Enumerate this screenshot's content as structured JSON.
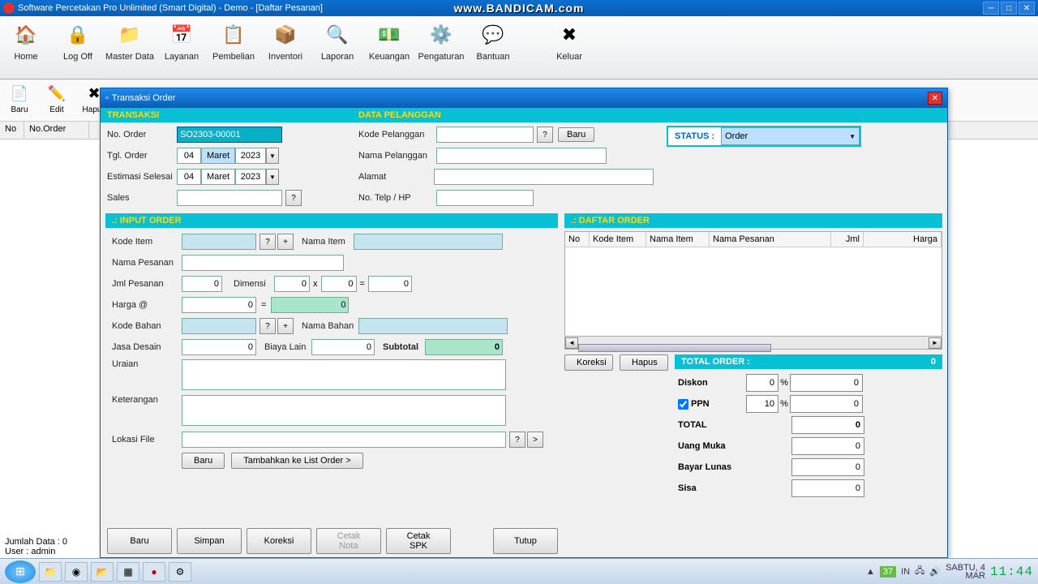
{
  "window": {
    "title": "Software Percetakan Pro Unlimited (Smart Digital) - Demo - [Daftar Pesanan]",
    "watermark": "www.BANDICAM.com"
  },
  "toolbar": [
    {
      "label": "Home",
      "icon": "🏠"
    },
    {
      "label": "Log Off",
      "icon": "🔒"
    },
    {
      "label": "Master Data",
      "icon": "📁"
    },
    {
      "label": "Layanan",
      "icon": "📅"
    },
    {
      "label": "Pembelian",
      "icon": "📋"
    },
    {
      "label": "Inventori",
      "icon": "📦"
    },
    {
      "label": "Laporan",
      "icon": "🔍"
    },
    {
      "label": "Keuangan",
      "icon": "💵"
    },
    {
      "label": "Pengaturan",
      "icon": "⚙️"
    },
    {
      "label": "Bantuan",
      "icon": "💬"
    },
    {
      "label": "Keluar",
      "icon": "✖"
    }
  ],
  "subtoolbar": [
    {
      "label": "Baru",
      "icon": "📄"
    },
    {
      "label": "Edit",
      "icon": "✏️"
    },
    {
      "label": "Hapus",
      "icon": "✖"
    }
  ],
  "list_cols": {
    "no": "No",
    "noorder": "No.Order"
  },
  "modal": {
    "title": "Transaksi Order",
    "sec_transaksi": "TRANSAKSI",
    "sec_pelanggan": "DATA PELANGGAN",
    "sec_input": ".: INPUT ORDER",
    "sec_daftar": ".: DAFTAR ORDER",
    "labels": {
      "no_order": "No. Order",
      "tgl_order": "Tgl. Order",
      "estimasi": "Estimasi Selesai",
      "sales": "Sales",
      "kode_pel": "Kode Pelanggan",
      "nama_pel": "Nama Pelanggan",
      "alamat": "Alamat",
      "telp": "No. Telp / HP",
      "status": "STATUS  :",
      "kode_item": "Kode Item",
      "nama_item": "Nama Item",
      "nama_pesanan": "Nama Pesanan",
      "jml": "Jml Pesanan",
      "dimensi": "Dimensi",
      "harga": "Harga @",
      "kode_bahan": "Kode Bahan",
      "nama_bahan": "Nama Bahan",
      "jasa": "Jasa Desain",
      "biaya": "Biaya Lain",
      "subtotal": "Subtotal",
      "uraian": "Uraian",
      "ket": "Keterangan",
      "lokasi": "Lokasi File",
      "baru": "Baru",
      "tambah": "Tambahkan ke List Order >",
      "q": "?",
      "plus": "+",
      "x": "x",
      "eq": "=",
      "gt": ">"
    },
    "values": {
      "no_order": "SO2303-00001",
      "tgl_d": "04",
      "tgl_m": "Maret",
      "tgl_y": "2023",
      "est_d": "04",
      "est_m": "Maret",
      "est_y": "2023",
      "status": "Order",
      "jml": "0",
      "dim1": "0",
      "dim2": "0",
      "dimres": "0",
      "harga": "0",
      "harga_tot": "0",
      "jasa": "0",
      "biaya": "0",
      "subtotal": "0"
    },
    "grid_cols": {
      "no": "No",
      "kode": "Kode Item",
      "nama": "Nama Item",
      "pesanan": "Nama Pesanan",
      "jml": "Jml",
      "harga": "Harga"
    },
    "actions": {
      "koreksi": "Koreksi",
      "hapus": "Hapus"
    },
    "total": {
      "title": "TOTAL ORDER  :",
      "title_val": "0",
      "diskon": "Diskon",
      "diskon_v": "0",
      "diskon_amt": "0",
      "ppn": "PPN",
      "ppn_v": "10",
      "ppn_amt": "0",
      "total": "TOTAL",
      "total_v": "0",
      "uang": "Uang Muka",
      "uang_v": "0",
      "lunas": "Bayar Lunas",
      "lunas_v": "0",
      "sisa": "Sisa",
      "sisa_v": "0",
      "pct": "%"
    },
    "bottom": {
      "baru": "Baru",
      "simpan": "Simpan",
      "koreksi": "Koreksi",
      "cetak_nota": "Cetak Nota",
      "cetak_spk": "Cetak SPK",
      "tutup": "Tutup"
    }
  },
  "status": {
    "jumlah": "Jumlah Data : 0",
    "user": "User : admin"
  },
  "tray": {
    "count": "37",
    "lang": "IN",
    "day": "SABTU, 4",
    "month": "MAR",
    "clock": "11:44"
  }
}
